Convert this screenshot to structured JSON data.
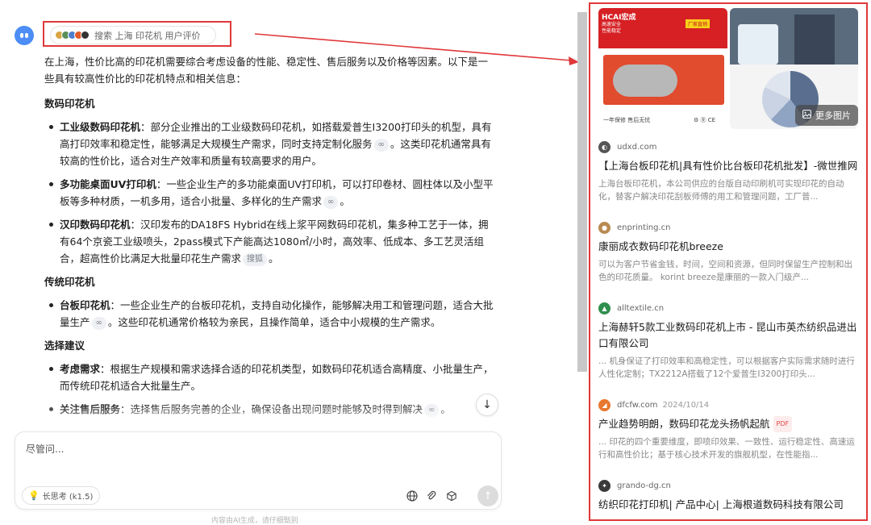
{
  "search": {
    "label": "搜索 上海 印花机 用户评价",
    "favicons": [
      "#d9a441",
      "#5a8f5c",
      "#4c7fd1",
      "#e25a2b",
      "#333333"
    ]
  },
  "answer": {
    "intro": "在上海，性价比高的印花机需要综合考虑设备的性能、稳定性、售后服务以及价格等因素。以下是一些具有较高性价比的印花机特点和相关信息：",
    "sections": [
      {
        "heading": "数码印花机",
        "items": [
          {
            "bold": "工业级数码印花机",
            "text": "：部分企业推出的工业级数码印花机，如搭载爱普生I3200打印头的机型，具有高打印效率和稳定性，能够满足大规模生产需求，同时支持定制化服务",
            "chip": "∞",
            "tail": "。这类印花机通常具有较高的性价比，适合对生产效率和质量有较高要求的用户。"
          },
          {
            "bold": "多功能桌面UV打印机",
            "text": "：一些企业生产的多功能桌面UV打印机，可以打印卷材、圆柱体以及小型平板等多种材质，一机多用，适合小批量、多样化的生产需求",
            "chip": "∞",
            "tail": "。"
          },
          {
            "bold": "汉印数码印花机",
            "text": "：汉印发布的DA18FS Hybrid在线上浆平网数码印花机，集多种工艺于一体，拥有64个京瓷工业级喷头，2pass模式下产能高达1080㎡/小时，高效率、低成本、多工艺灵活组合，超高性价比满足大批量印花生产需求",
            "chip": "搜狐",
            "tail": "。"
          }
        ]
      },
      {
        "heading": "传统印花机",
        "items": [
          {
            "bold": "台板印花机",
            "text": "：一些企业生产的台板印花机，支持自动化操作，能够解决用工和管理问题，适合大批量生产",
            "chip": "∞",
            "tail": "。这些印花机通常价格较为亲民，且操作简单，适合中小规模的生产需求。"
          }
        ]
      },
      {
        "heading": "选择建议",
        "items": [
          {
            "bold": "考虑需求",
            "text": "：根据生产规模和需求选择合适的印花机类型，如数码印花机适合高精度、小批量生产，而传统印花机适合大批量生产。",
            "chip": "",
            "tail": ""
          },
          {
            "bold": "关注售后服务",
            "text": "：选择售后服务完善的企业，确保设备出现问题时能够及时得到解决",
            "chip": "∞",
            "tail": "。"
          }
        ]
      }
    ]
  },
  "composer": {
    "placeholder": "尽管问...",
    "think_label": "长思考 (k1.5)",
    "icons": [
      "globe-icon",
      "attachment-icon",
      "cube-icon"
    ],
    "send_icon": "arrow-up-icon"
  },
  "disclaimer": "内容由AI生成，请仔细甄别",
  "images_panel": {
    "img1": {
      "brand": "HCAI宏成",
      "sub": "高速安全\n性能稳定",
      "tag": "厂家直销",
      "footer": "一年保修 售后无忧",
      "cert": "⚙ Ⓡ CE"
    },
    "more_images_label": "更多图片"
  },
  "results": [
    {
      "domain": "udxd.com",
      "date": "",
      "pdf": false,
      "favicon_color": "#555555",
      "favicon_glyph": "◐",
      "title": "【上海台板印花机|具有性价比台板印花机批发】-微世推网",
      "snippet": "上海台板印花机，本公司供应的台版自动印刷机可实现印花的自动化，替客户解决印花刮板师傅的用工和管理问题，工厂普..."
    },
    {
      "domain": "enprinting.cn",
      "date": "",
      "pdf": false,
      "favicon_color": "#b98a52",
      "favicon_glyph": "●",
      "title": "康丽成衣数码印花机breeze",
      "snippet": "可以为客户节省金钱，时间，空间和资源，但同时保留生产控制和出色的印花质量。 korint breeze是康丽的一款入门级产..."
    },
    {
      "domain": "alltextile.cn",
      "date": "",
      "pdf": false,
      "favicon_color": "#2f8f4e",
      "favicon_glyph": "▲",
      "title": "上海赫轩5款工业数码印花机上市 - 昆山市英杰纺织品进出口有限公司",
      "snippet": "... 机身保证了打印效率和高稳定性，可以根据客户实际需求随时进行人性化定制；TX2212A搭载了12个爱普生I3200打印头..."
    },
    {
      "domain": "dfcfw.com",
      "date": "2024/10/14",
      "pdf": true,
      "pdf_label": "PDF",
      "favicon_color": "#e8772e",
      "favicon_glyph": "◢",
      "title": "产业趋势明朗，数码印花龙头扬帆起航",
      "snippet": "... 印花的四个重要维度，即喷印效果、一致性、运行稳定性、高速运行和高性价比；基于核心技术开发的旗舰机型，在性能指..."
    },
    {
      "domain": "grando-dg.cn",
      "date": "",
      "pdf": false,
      "favicon_color": "#3a3a3a",
      "favicon_glyph": "✦",
      "title": "纺织印花打印机| 产品中心| 上海根道数码科技有限公司",
      "snippet": ""
    }
  ]
}
